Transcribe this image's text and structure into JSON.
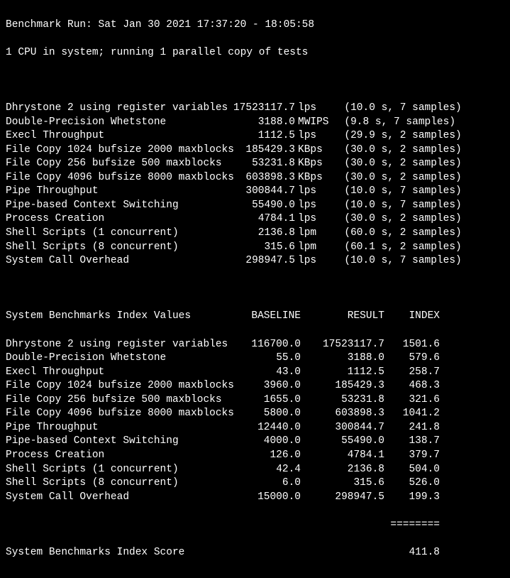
{
  "header": {
    "run_line": "Benchmark Run: Sat Jan 30 2021 17:37:20 - 18:05:58",
    "cpu_line": "1 CPU in system; running 1 parallel copy of tests"
  },
  "results": [
    {
      "name": "Dhrystone 2 using register variables",
      "value": "17523117.7",
      "unit": "lps",
      "detail": "(10.0 s, 7 samples)"
    },
    {
      "name": "Double-Precision Whetstone",
      "value": "3188.0",
      "unit": "MWIPS",
      "detail": "(9.8 s, 7 samples)"
    },
    {
      "name": "Execl Throughput",
      "value": "1112.5",
      "unit": "lps",
      "detail": "(29.9 s, 2 samples)"
    },
    {
      "name": "File Copy 1024 bufsize 2000 maxblocks",
      "value": "185429.3",
      "unit": "KBps",
      "detail": "(30.0 s, 2 samples)"
    },
    {
      "name": "File Copy 256 bufsize 500 maxblocks",
      "value": "53231.8",
      "unit": "KBps",
      "detail": "(30.0 s, 2 samples)"
    },
    {
      "name": "File Copy 4096 bufsize 8000 maxblocks",
      "value": "603898.3",
      "unit": "KBps",
      "detail": "(30.0 s, 2 samples)"
    },
    {
      "name": "Pipe Throughput",
      "value": "300844.7",
      "unit": "lps",
      "detail": "(10.0 s, 7 samples)"
    },
    {
      "name": "Pipe-based Context Switching",
      "value": "55490.0",
      "unit": "lps",
      "detail": "(10.0 s, 7 samples)"
    },
    {
      "name": "Process Creation",
      "value": "4784.1",
      "unit": "lps",
      "detail": "(30.0 s, 2 samples)"
    },
    {
      "name": "Shell Scripts (1 concurrent)",
      "value": "2136.8",
      "unit": "lpm",
      "detail": "(60.0 s, 2 samples)"
    },
    {
      "name": "Shell Scripts (8 concurrent)",
      "value": "315.6",
      "unit": "lpm",
      "detail": "(60.1 s, 2 samples)"
    },
    {
      "name": "System Call Overhead",
      "value": "298947.5",
      "unit": "lps",
      "detail": "(10.0 s, 7 samples)"
    }
  ],
  "index_header": {
    "title": "System Benchmarks Index Values",
    "baseline": "BASELINE",
    "result": "RESULT",
    "index": "INDEX"
  },
  "index_rows": [
    {
      "name": "Dhrystone 2 using register variables",
      "baseline": "116700.0",
      "result": "17523117.7",
      "index": "1501.6"
    },
    {
      "name": "Double-Precision Whetstone",
      "baseline": "55.0",
      "result": "3188.0",
      "index": "579.6"
    },
    {
      "name": "Execl Throughput",
      "baseline": "43.0",
      "result": "1112.5",
      "index": "258.7"
    },
    {
      "name": "File Copy 1024 bufsize 2000 maxblocks",
      "baseline": "3960.0",
      "result": "185429.3",
      "index": "468.3"
    },
    {
      "name": "File Copy 256 bufsize 500 maxblocks",
      "baseline": "1655.0",
      "result": "53231.8",
      "index": "321.6"
    },
    {
      "name": "File Copy 4096 bufsize 8000 maxblocks",
      "baseline": "5800.0",
      "result": "603898.3",
      "index": "1041.2"
    },
    {
      "name": "Pipe Throughput",
      "baseline": "12440.0",
      "result": "300844.7",
      "index": "241.8"
    },
    {
      "name": "Pipe-based Context Switching",
      "baseline": "4000.0",
      "result": "55490.0",
      "index": "138.7"
    },
    {
      "name": "Process Creation",
      "baseline": "126.0",
      "result": "4784.1",
      "index": "379.7"
    },
    {
      "name": "Shell Scripts (1 concurrent)",
      "baseline": "42.4",
      "result": "2136.8",
      "index": "504.0"
    },
    {
      "name": "Shell Scripts (8 concurrent)",
      "baseline": "6.0",
      "result": "315.6",
      "index": "526.0"
    },
    {
      "name": "System Call Overhead",
      "baseline": "15000.0",
      "result": "298947.5",
      "index": "199.3"
    }
  ],
  "separator": "========",
  "final": {
    "label": "System Benchmarks Index Score",
    "value": "411.8"
  }
}
